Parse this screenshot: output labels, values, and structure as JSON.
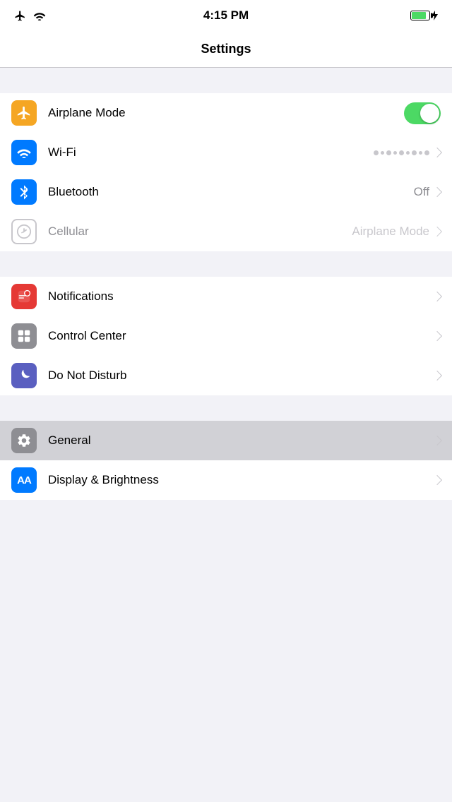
{
  "statusBar": {
    "time": "4:15 PM"
  },
  "navBar": {
    "title": "Settings"
  },
  "groups": [
    {
      "id": "connectivity",
      "items": [
        {
          "id": "airplane-mode",
          "label": "Airplane Mode",
          "iconType": "airplane",
          "iconColor": "orange",
          "hasToggle": true,
          "toggleOn": true,
          "value": "",
          "disabled": false
        },
        {
          "id": "wifi",
          "label": "Wi-Fi",
          "iconType": "wifi",
          "iconColor": "blue",
          "hasToggle": false,
          "hasChevron": true,
          "value": "",
          "showDots": true,
          "disabled": false
        },
        {
          "id": "bluetooth",
          "label": "Bluetooth",
          "iconType": "bluetooth",
          "iconColor": "blue",
          "hasToggle": false,
          "hasChevron": true,
          "value": "Off",
          "disabled": false
        },
        {
          "id": "cellular",
          "label": "Cellular",
          "iconType": "cellular",
          "iconColor": "green-outline",
          "hasToggle": false,
          "hasChevron": true,
          "value": "Airplane Mode",
          "disabled": true
        }
      ]
    },
    {
      "id": "system",
      "items": [
        {
          "id": "notifications",
          "label": "Notifications",
          "iconType": "notifications",
          "iconColor": "red",
          "hasToggle": false,
          "hasChevron": true,
          "value": "",
          "disabled": false
        },
        {
          "id": "control-center",
          "label": "Control Center",
          "iconType": "control-center",
          "iconColor": "gray",
          "hasToggle": false,
          "hasChevron": true,
          "value": "",
          "disabled": false
        },
        {
          "id": "do-not-disturb",
          "label": "Do Not Disturb",
          "iconType": "do-not-disturb",
          "iconColor": "indigo",
          "hasToggle": false,
          "hasChevron": true,
          "value": "",
          "disabled": false
        }
      ]
    },
    {
      "id": "device",
      "items": [
        {
          "id": "general",
          "label": "General",
          "iconType": "gear",
          "iconColor": "gear",
          "hasToggle": false,
          "hasChevron": true,
          "value": "",
          "disabled": false,
          "selected": true
        },
        {
          "id": "display-brightness",
          "label": "Display & Brightness",
          "iconType": "display",
          "iconColor": "blue-aa",
          "hasToggle": false,
          "hasChevron": true,
          "value": "",
          "disabled": false,
          "selected": false
        }
      ]
    }
  ]
}
